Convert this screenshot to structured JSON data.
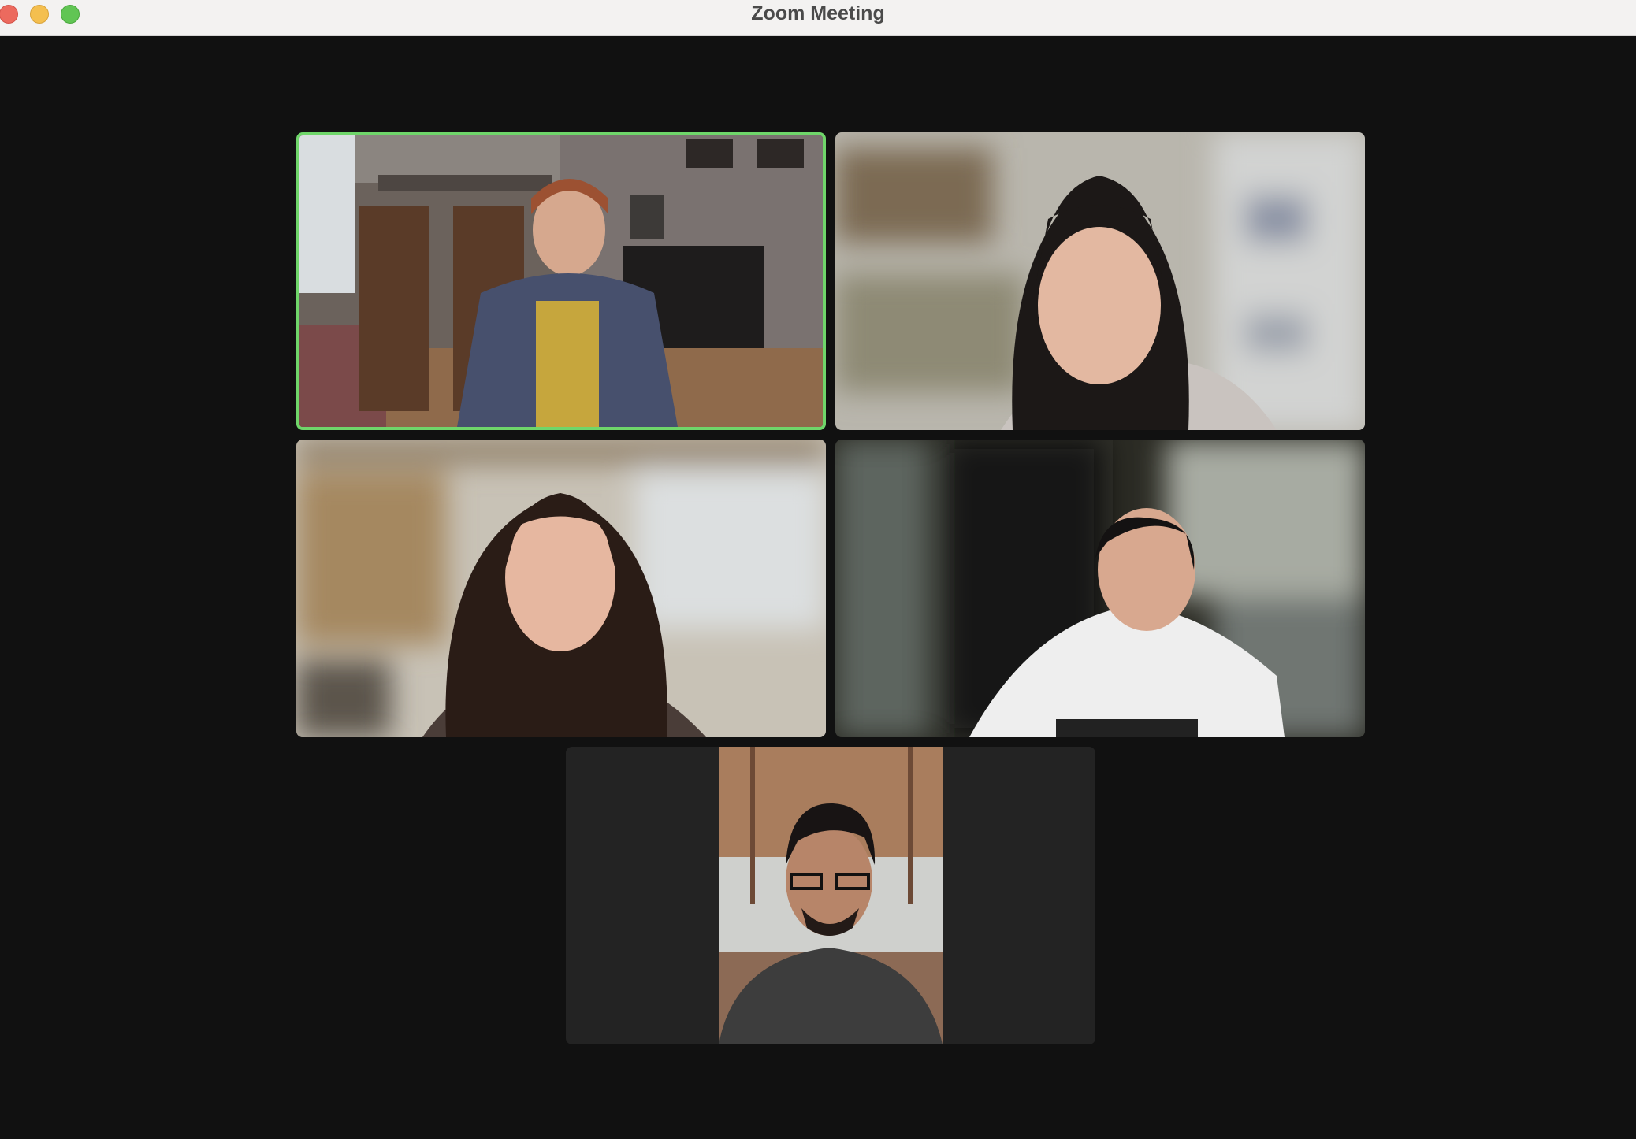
{
  "window": {
    "title": "Zoom Meeting",
    "controls": [
      "close",
      "minimize",
      "zoom"
    ]
  },
  "gallery": {
    "layout": "gallery-view",
    "tiles": [
      {
        "position": "top-left",
        "active_speaker": true,
        "highlight_color": "#6fd66a",
        "content": "participant-video"
      },
      {
        "position": "top-right",
        "active_speaker": false,
        "content": "participant-video"
      },
      {
        "position": "middle-left",
        "active_speaker": false,
        "content": "participant-video"
      },
      {
        "position": "middle-right",
        "active_speaker": false,
        "content": "participant-video"
      },
      {
        "position": "bottom-center",
        "active_speaker": false,
        "content": "participant-video",
        "aspect": "portrait"
      }
    ]
  },
  "colors": {
    "background": "#111111",
    "titlebar": "#f3f2f1",
    "active_border": "#6fd66a",
    "close": "#ec6a5e",
    "minimize": "#f4bf4f",
    "zoom": "#61c554"
  }
}
